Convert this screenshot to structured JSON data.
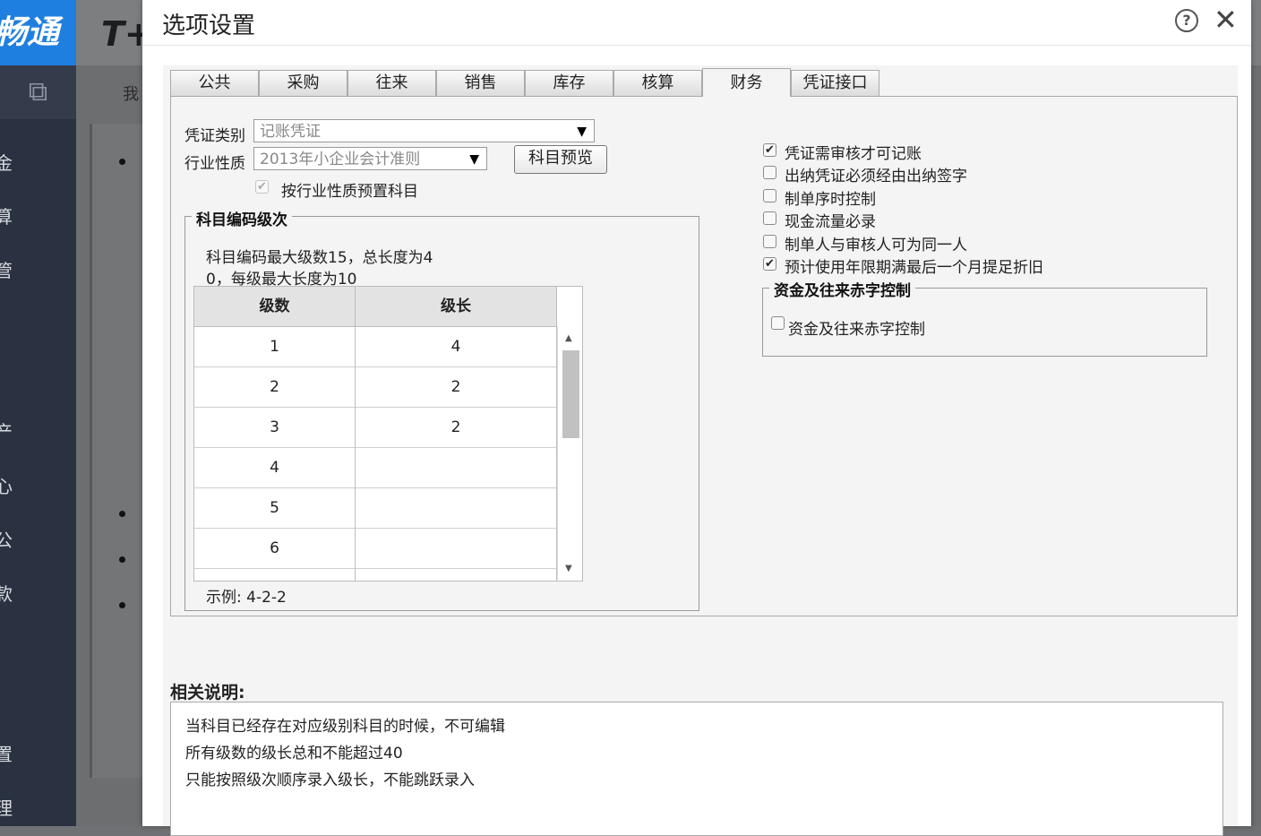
{
  "background_app": {
    "logo": "畅通",
    "brand": "T+",
    "tab_text": "我",
    "sidebar_items": [
      "金",
      "算",
      "管",
      "产",
      "心",
      "公",
      "款",
      "置",
      "理"
    ]
  },
  "dialog": {
    "title": "选项设置",
    "help_icon": "?",
    "close_icon": "✕",
    "tabs": [
      "公共",
      "采购",
      "往来",
      "销售",
      "库存",
      "核算",
      "财务",
      "凭证接口"
    ],
    "active_tab": "财务",
    "voucher_type": {
      "label": "凭证类别",
      "value": "记账凭证"
    },
    "industry": {
      "label": "行业性质",
      "value": "2013年小企业会计准则"
    },
    "preview_button": "科目预览",
    "preset_checkbox": {
      "label": "按行业性质预置科目",
      "checked": true,
      "disabled": true
    },
    "code_levels": {
      "legend": "科目编码级次",
      "desc_line1": "科目编码最大级数15，总长度为4",
      "desc_line2": "0，每级最大长度为10",
      "columns": [
        "级数",
        "级长"
      ],
      "rows": [
        {
          "level": "1",
          "length": "4"
        },
        {
          "level": "2",
          "length": "2"
        },
        {
          "level": "3",
          "length": "2"
        },
        {
          "level": "4",
          "length": ""
        },
        {
          "level": "5",
          "length": ""
        },
        {
          "level": "6",
          "length": ""
        }
      ],
      "example": "示例:  4-2-2"
    },
    "options": [
      {
        "label": "凭证需审核才可记账",
        "checked": true
      },
      {
        "label": "出纳凭证必须经由出纳签字",
        "checked": false
      },
      {
        "label": "制单序时控制",
        "checked": false
      },
      {
        "label": "现金流量必录",
        "checked": false
      },
      {
        "label": "制单人与审核人可为同一人",
        "checked": false
      },
      {
        "label": "预计使用年限期满最后一个月提足折旧",
        "checked": true
      }
    ],
    "deficit_control": {
      "legend": "资金及往来赤字控制",
      "checkbox_label": "资金及往来赤字控制",
      "checked": false
    },
    "notes": {
      "title": "相关说明:",
      "lines": [
        "当科目已经存在对应级别科目的时候，不可编辑",
        "所有级数的级长总和不能超过40",
        "只能按照级次顺序录入级长，不能跳跃录入"
      ]
    }
  }
}
